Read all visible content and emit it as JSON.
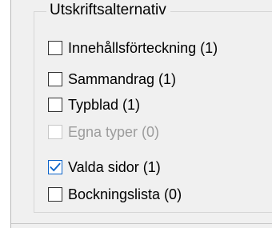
{
  "group": {
    "title": "Utskriftsalternativ"
  },
  "options": [
    {
      "label": "Innehållsförteckning (1)",
      "checked": false,
      "enabled": true
    },
    {
      "label": "Sammandrag (1)",
      "checked": false,
      "enabled": true
    },
    {
      "label": "Typblad (1)",
      "checked": false,
      "enabled": true
    },
    {
      "label": "Egna typer (0)",
      "checked": false,
      "enabled": false
    },
    {
      "label": "Valda sidor (1)",
      "checked": true,
      "enabled": true
    },
    {
      "label": "Bockningslista (0)",
      "checked": false,
      "enabled": true
    }
  ],
  "colors": {
    "check": "#0a63c9",
    "disabled_text": "#9c9c9c"
  }
}
